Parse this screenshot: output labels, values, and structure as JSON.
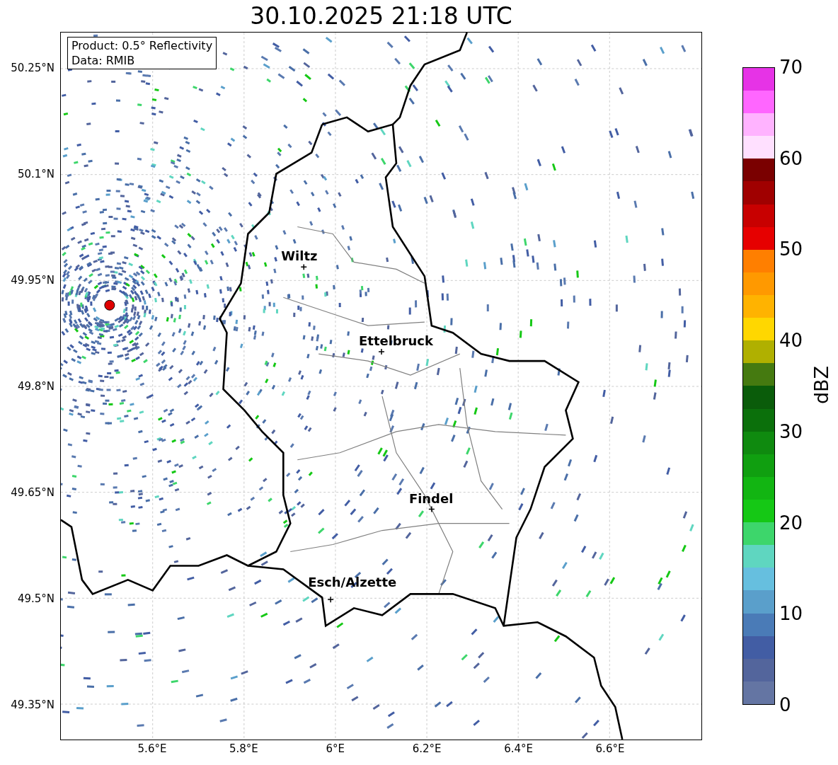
{
  "title": "30.10.2025 21:18 UTC",
  "info_box": [
    "Product: 0.5° Reflectivity",
    "Data: RMIB"
  ],
  "y_ticks": [
    "50.25°N",
    "50.1°N",
    "49.95°N",
    "49.8°N",
    "49.65°N",
    "49.5°N",
    "49.35°N"
  ],
  "x_ticks": [
    "5.6°E",
    "5.8°E",
    "6°E",
    "6.2°E",
    "6.4°E",
    "6.6°E"
  ],
  "cities": [
    {
      "name": "Wiltz"
    },
    {
      "name": "Ettelbruck"
    },
    {
      "name": "Findel"
    },
    {
      "name": "Esch/Alzette"
    }
  ],
  "colorbar": {
    "label": "dBZ",
    "ticks": [
      "70",
      "60",
      "50",
      "40",
      "30",
      "20",
      "10",
      "0"
    ],
    "steps": [
      {
        "color": "#6475a3"
      },
      {
        "color": "#53659c"
      },
      {
        "color": "#425da4"
      },
      {
        "color": "#4a7bb7"
      },
      {
        "color": "#5a9fcb"
      },
      {
        "color": "#66bfdf"
      },
      {
        "color": "#5fd6c0"
      },
      {
        "color": "#3dd66b"
      },
      {
        "color": "#15c815"
      },
      {
        "color": "#12b512"
      },
      {
        "color": "#109f10"
      },
      {
        "color": "#0f8a0f"
      },
      {
        "color": "#0b700b"
      },
      {
        "color": "#0a5c0a"
      },
      {
        "color": "#457a10"
      },
      {
        "color": "#b0b000"
      },
      {
        "color": "#ffd700"
      },
      {
        "color": "#ffb300"
      },
      {
        "color": "#ff9900"
      },
      {
        "color": "#ff7f00"
      },
      {
        "color": "#e60000"
      },
      {
        "color": "#c80000"
      },
      {
        "color": "#a00000"
      },
      {
        "color": "#7a0000"
      },
      {
        "color": "#ffe0ff"
      },
      {
        "color": "#ffb3ff"
      },
      {
        "color": "#ff66ff"
      },
      {
        "color": "#e633e6"
      }
    ]
  }
}
